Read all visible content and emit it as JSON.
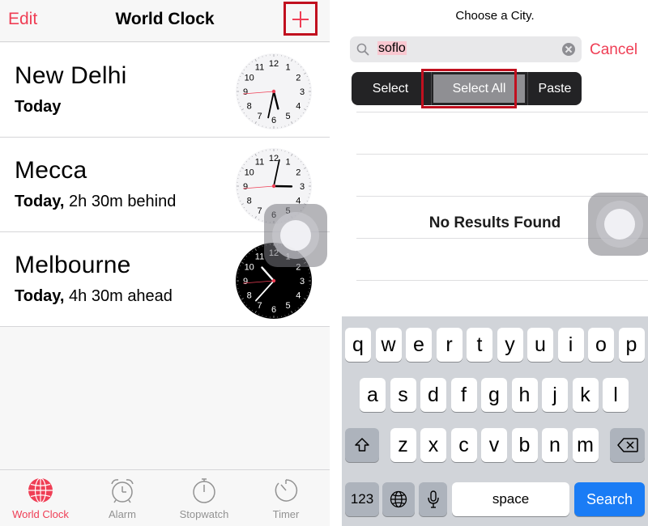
{
  "left": {
    "nav": {
      "edit": "Edit",
      "title": "World Clock"
    },
    "clocks": [
      {
        "city": "New Delhi",
        "day": "Today",
        "offset": "",
        "dark": false,
        "hour": 5,
        "minute": 32
      },
      {
        "city": "Mecca",
        "day": "Today,",
        "offset": "2h 30m behind",
        "dark": false,
        "hour": 3,
        "minute": 2
      },
      {
        "city": "Melbourne",
        "day": "Today,",
        "offset": "4h 30m ahead",
        "dark": true,
        "hour": 10,
        "minute": 37
      }
    ],
    "clock_numbers": [
      "12",
      "1",
      "2",
      "3",
      "4",
      "5",
      "6",
      "7",
      "8",
      "9",
      "10",
      "11"
    ],
    "tabs": [
      {
        "label": "World Clock",
        "icon": "globe-icon",
        "active": true
      },
      {
        "label": "Alarm",
        "icon": "alarm-clock-icon",
        "active": false
      },
      {
        "label": "Stopwatch",
        "icon": "stopwatch-icon",
        "active": false
      },
      {
        "label": "Timer",
        "icon": "timer-icon",
        "active": false
      }
    ],
    "accent_color": "#ef3e55",
    "highlight_color": "#c1101f"
  },
  "right": {
    "title": "Choose a City.",
    "search": {
      "value": "soflo",
      "selected_text": "soflo"
    },
    "cancel": "Cancel",
    "edit_menu": [
      "Select",
      "Select All",
      "Paste"
    ],
    "no_results": "No Results Found",
    "keyboard": {
      "row1": [
        "q",
        "w",
        "e",
        "r",
        "t",
        "y",
        "u",
        "i",
        "o",
        "p"
      ],
      "row2": [
        "a",
        "s",
        "d",
        "f",
        "g",
        "h",
        "j",
        "k",
        "l"
      ],
      "row3": [
        "z",
        "x",
        "c",
        "v",
        "b",
        "n",
        "m"
      ],
      "numbers_key": "123",
      "space_key": "space",
      "search_key": "Search"
    }
  }
}
